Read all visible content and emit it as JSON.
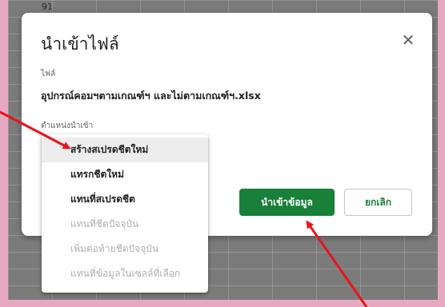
{
  "background": {
    "row_number": "91"
  },
  "dialog": {
    "title": "นำเข้าไฟล์",
    "close_icon": "close-icon",
    "file_label": "ไฟล์",
    "file_name": "อุปกรณ์คอมฯตามเกณฑ์ฯ และไม่ตามเกณฑ์ฯ.xlsx",
    "location_label": "ตำแหน่งนำเข้า",
    "import_button": "นำเข้าข้อมูล",
    "cancel_button": "ยกเลิก"
  },
  "dropdown": {
    "items": [
      {
        "label": "สร้างสเปรดชีตใหม่",
        "state": "selected"
      },
      {
        "label": "แทรกชีตใหม่",
        "state": "enabled"
      },
      {
        "label": "แทนที่สเปรดชีต",
        "state": "enabled"
      },
      {
        "label": "แทนที่ชีตปัจจุบัน",
        "state": "disabled"
      },
      {
        "label": "เพิ่มต่อท้ายชีตปัจจุบัน",
        "state": "disabled"
      },
      {
        "label": "แทนที่ข้อมูลในเซลล์ที่เลือก",
        "state": "disabled"
      }
    ]
  },
  "colors": {
    "accent_green": "#188038",
    "annotation_red": "#e8141c",
    "page_pink": "#e6a9c1"
  }
}
